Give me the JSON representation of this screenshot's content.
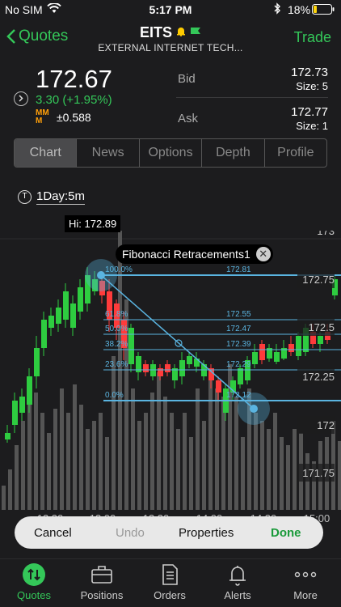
{
  "status": {
    "carrier": "No SIM",
    "time": "5:17 PM",
    "battery": "18%"
  },
  "nav": {
    "back_label": "Quotes",
    "symbol": "EITS",
    "company": "EXTERNAL INTERNET TECH...",
    "trade_label": "Trade"
  },
  "quote": {
    "last": "172.67",
    "change": "3.30 (+1.95%)",
    "mm_label": "MM M",
    "mm_value": "±0.588",
    "bid_label": "Bid",
    "bid": "172.73",
    "bid_size": "Size: 5",
    "ask_label": "Ask",
    "ask": "172.77",
    "ask_size": "Size: 1"
  },
  "tabs": [
    "Chart",
    "News",
    "Options",
    "Depth",
    "Profile"
  ],
  "chart": {
    "period": "1Day:5m",
    "high_label": "Hi: 172.89",
    "drawing_label": "Fibonacci Retracements1",
    "price_ticks": [
      "173",
      "172.75",
      "172.5",
      "172.25",
      "172",
      "171.75"
    ],
    "time_ticks": [
      "12:30",
      "13:00",
      "13:30",
      "14:00",
      "14:30",
      "15:00"
    ],
    "fib_levels": [
      {
        "pct": "100.0%",
        "price": "172.81"
      },
      {
        "pct": "61.8%",
        "price": "172.55"
      },
      {
        "pct": "50.0%",
        "price": "172.47"
      },
      {
        "pct": "38.2%",
        "price": "172.39"
      },
      {
        "pct": "23.6%",
        "price": "172.29"
      },
      {
        "pct": "0.0%",
        "price": "172.12"
      }
    ],
    "colors": {
      "up": "#2ecc40",
      "down": "#ff3b3b",
      "fib": "#5ab4e0",
      "volume": "#555555"
    }
  },
  "actions": {
    "cancel": "Cancel",
    "undo": "Undo",
    "properties": "Properties",
    "done": "Done"
  },
  "tabbar": [
    {
      "label": "Quotes",
      "icon": "quotes-icon"
    },
    {
      "label": "Positions",
      "icon": "briefcase-icon"
    },
    {
      "label": "Orders",
      "icon": "document-icon"
    },
    {
      "label": "Alerts",
      "icon": "bell-icon"
    },
    {
      "label": "More",
      "icon": "more-dots-icon"
    }
  ]
}
